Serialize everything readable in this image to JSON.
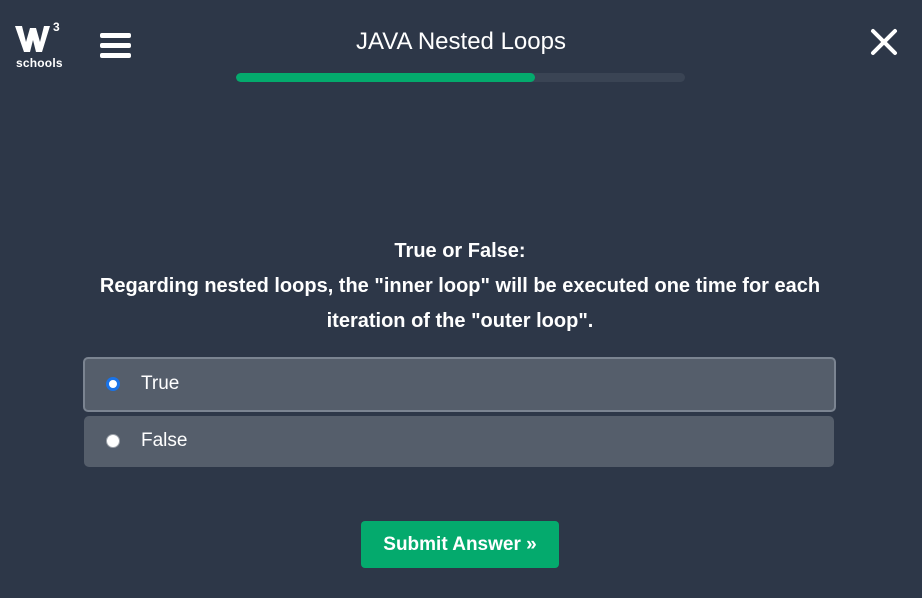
{
  "header": {
    "logo_text": "schools",
    "logo_sup": "3",
    "title": "JAVA Nested Loops",
    "progress": 0.665,
    "icons": {
      "logo": "w3schools-logo-icon",
      "menu": "hamburger-menu-icon",
      "close": "close-icon"
    }
  },
  "question": {
    "heading": "True or False:",
    "line_1": "Regarding nested loops, the \"inner loop\" will be executed one time for each",
    "line_2": "iteration of the \"outer loop\"."
  },
  "options": [
    {
      "label": "True",
      "selected": true
    },
    {
      "label": "False",
      "selected": false
    }
  ],
  "submit": {
    "label": "Submit Answer »"
  },
  "colors": {
    "background": "#2d3748",
    "accent": "#04aa6d",
    "option_bg": "#555e6b",
    "radio_selected": "#1a73e8"
  }
}
